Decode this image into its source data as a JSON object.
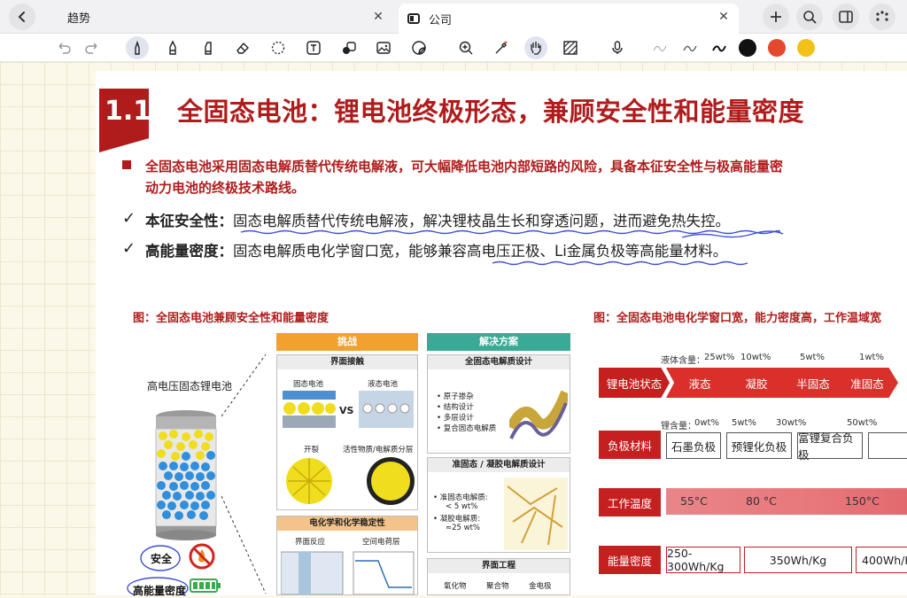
{
  "tabs": [
    {
      "label": "趋势"
    },
    {
      "label": "公司"
    }
  ],
  "icons": {
    "back": "chevron-left-icon",
    "close": "close-icon",
    "add": "plus-icon",
    "search": "search-icon",
    "sidebar": "sidebar-icon",
    "more": "more-icon"
  },
  "toolbar": {
    "colors": {
      "black": "#111111",
      "red": "#e5492d",
      "yellow": "#f2c21a"
    },
    "tools": [
      "undo",
      "redo",
      "pen",
      "pencil",
      "highlighter",
      "eraser",
      "lasso",
      "text",
      "shapes",
      "image",
      "sticker",
      "zoom",
      "laser",
      "hand",
      "pattern",
      "microphone",
      "thin-stroke",
      "medium-stroke",
      "thick-stroke"
    ]
  },
  "slide": {
    "section_number": "1.1",
    "title": "全固态电池：锂电池终极形态，兼顾安全性和能量密度",
    "intro_line1": "全固态电池采用固态电解质替代传统电解液，可大幅降低电池内部短路的风险，具备本征安全性与极高能量密",
    "intro_line2": "动力电池的终极技术路线。",
    "check_mark": "✓",
    "point1_head": "本征安全性：",
    "point1_body": "固态电解质替代传统电解液，解决锂枝晶生长和穿透问题，进而避免热失控。",
    "point2_head": "高能量密度：",
    "point2_body": "固态电解质电化学窗口宽，能够兼容高电压正极、Li金属负极等高能量材料。"
  },
  "left_figure": {
    "caption": "图：全固态电池兼顾安全性和能量密度",
    "battery_label": "高电压固态锂电池",
    "label_safety": "安全",
    "label_energy": "高能量密度",
    "challenge_header": "挑战",
    "solution_header": "解决方案",
    "panel_interface": "界面接触",
    "solid_label": "固态电池",
    "liquid_label": "液态电池",
    "vs": "VS",
    "crack_label": "开裂",
    "layering_label": "活性物质/电解质分层",
    "panel_electrochem": "电化学和化学稳定性",
    "interface_reaction": "界面反应",
    "space_charge": "空间电荷层",
    "sol_all_solid": "全固态电解质设计",
    "sol_items": [
      "原子掺杂",
      "结构设计",
      "多层设计",
      "复合固态电解质"
    ],
    "sol_quasi": "准固态 / 凝胶电解质设计",
    "quasi_items": [
      "准固态电解质:",
      "< 5 wt%",
      "凝胶电解质:",
      "≈25 wt%"
    ],
    "sol_interface_eng": "界面工程",
    "ie_items": [
      "氧化物",
      "聚合物",
      "金电极"
    ]
  },
  "right_figure": {
    "caption": "图：全固态电池电化学窗口宽，能力密度高，工作温域宽",
    "liquid_content_label": "液体含量：",
    "liquid_content_values": [
      "25wt%",
      "10wt%",
      "5wt%",
      "1wt%"
    ],
    "row_state_label": "锂电池状态",
    "states": [
      "液态",
      "凝胶",
      "半固态",
      "准固态"
    ],
    "lithium_content_label": "锂含量：",
    "lithium_content_values": [
      "0wt%",
      "5wt%",
      "30wt%",
      "50wt%"
    ],
    "row_anode_label": "负极材料",
    "anodes": [
      "石墨负极",
      "预锂化负极",
      "富锂复合负极"
    ],
    "row_temp_label": "工作温度",
    "temps": [
      "55°C",
      "80 °C",
      "150°C"
    ],
    "row_energy_label": "能量密度",
    "energies": [
      "250-300Wh/Kg",
      "350Wh/Kg",
      "400Wh/Kg"
    ]
  }
}
